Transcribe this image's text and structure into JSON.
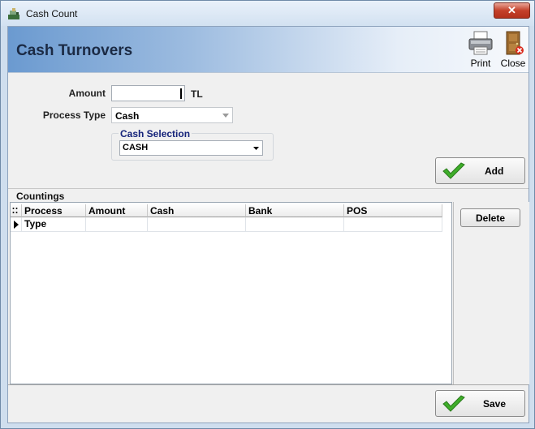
{
  "window": {
    "title": "Cash Count",
    "close_glyph": "✕"
  },
  "header": {
    "title": "Cash Turnovers"
  },
  "toolbar": {
    "print_label": "Print",
    "print_icon": "printer-icon",
    "close_label": "Close",
    "close_icon": "door-exit-icon"
  },
  "form": {
    "amount_label": "Amount",
    "amount_value": "",
    "currency": "TL",
    "process_type_label": "Process Type",
    "process_type_value": "Cash",
    "cash_selection_title": "Cash Selection",
    "cash_selection_value": "CASH"
  },
  "buttons": {
    "add": "Add",
    "delete": "Delete",
    "save": "Save",
    "check_icon": "green-check-icon"
  },
  "countings": {
    "title": "Countings",
    "columns": [
      "Process Type",
      "Amount",
      "Cash",
      "Bank",
      "POS"
    ],
    "rows": []
  },
  "colors": {
    "header_gradient_start": "#6b9ad0",
    "title_text": "#1b2a44",
    "group_title": "#15237a",
    "check_green": "#3fae2a"
  }
}
